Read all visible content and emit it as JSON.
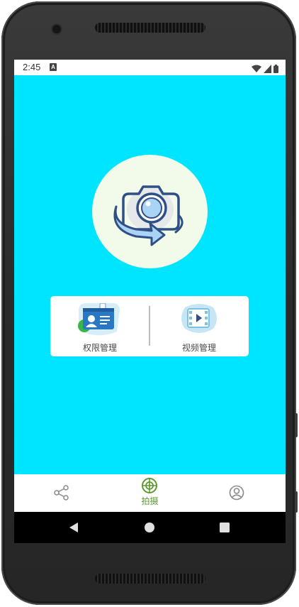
{
  "status_bar": {
    "time": "2:45",
    "notification_icon": "a-icon"
  },
  "hero": {
    "icon": "camera-rotate-icon"
  },
  "feature_card": {
    "items": [
      {
        "label": "权限管理",
        "icon": "id-badge-icon"
      },
      {
        "label": "视频管理",
        "icon": "video-film-icon"
      }
    ]
  },
  "bottom_nav": {
    "items": [
      {
        "label": "",
        "icon": "share-icon"
      },
      {
        "label": "拍摄",
        "icon": "camera-target-icon"
      },
      {
        "label": "",
        "icon": "profile-icon"
      }
    ]
  },
  "system_nav": [
    "back-icon",
    "home-icon",
    "recents-icon"
  ],
  "colors": {
    "screen_bg": "#00e5ff",
    "accent": "#5c9a2e",
    "hero_bg": "#f2fbe9"
  }
}
